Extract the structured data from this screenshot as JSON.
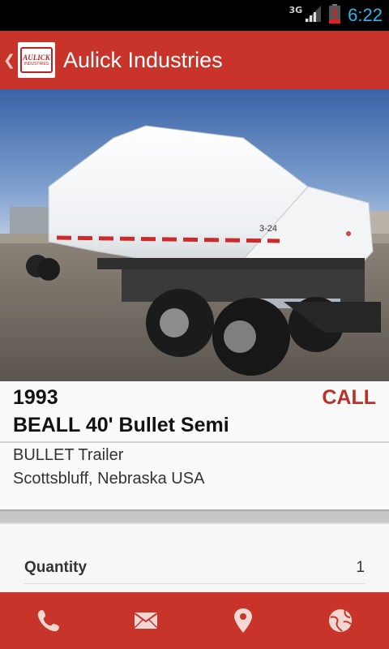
{
  "status_bar": {
    "network": "3G",
    "time": "6:22",
    "icons": [
      "signal-icon",
      "battery-low-icon"
    ]
  },
  "action_bar": {
    "title": "Aulick Industries",
    "logo": {
      "top": "AULICK",
      "bottom": "INDUSTRIES"
    }
  },
  "listing": {
    "year": "1993",
    "price": "CALL",
    "title": "BEALL 40' Bullet Semi",
    "category": "BULLET Trailer",
    "location": "Scottsbluff, Nebraska USA"
  },
  "specs": [
    {
      "label": "Quantity",
      "value": "1"
    }
  ],
  "photo_text": {
    "unit_number": "3-24"
  },
  "bottom_nav": {
    "items": [
      "phone-icon",
      "mail-icon",
      "map-pin-icon",
      "globe-icon"
    ]
  },
  "colors": {
    "brand_red": "#c8342a",
    "price_red": "#b83228",
    "time_blue": "#33b5e5"
  }
}
